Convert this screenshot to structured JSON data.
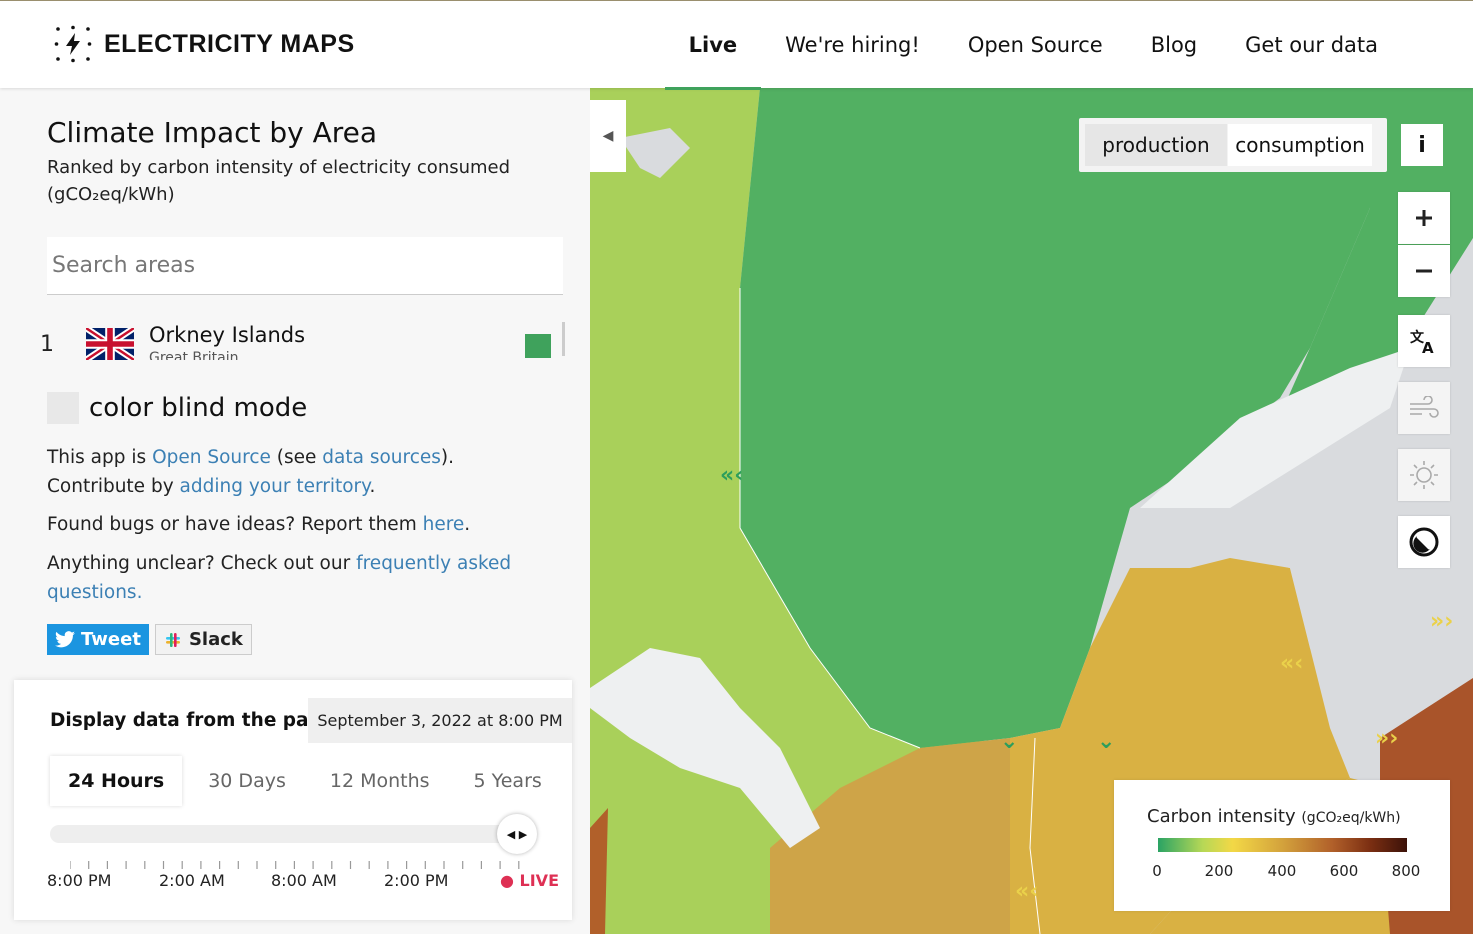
{
  "header": {
    "logo_text": "ELECTRICITY MAPS",
    "nav": [
      "Live",
      "We're hiring!",
      "Open Source",
      "Blog",
      "Get our data"
    ],
    "active_nav": "Live"
  },
  "sidebar": {
    "title": "Climate Impact by Area",
    "subtitle": "Ranked by carbon intensity of electricity consumed (gCO₂eq/kWh)",
    "search_placeholder": "Search areas",
    "ranking": [
      {
        "rank": "1",
        "name": "Orkney Islands",
        "country": "Great Britain",
        "color": "#3fa25c"
      }
    ],
    "color_blind_label": "color blind mode",
    "info": {
      "p1_a": "This app is ",
      "p1_link1": "Open Source",
      "p1_b": " (see ",
      "p1_link2": "data sources",
      "p1_c": "). Contribute by ",
      "p1_link3": "adding your territory",
      "p1_d": ".",
      "p2_a": "Found bugs or have ideas? Report them ",
      "p2_link": "here",
      "p2_b": ".",
      "p3_a": "Anything unclear? Check out our ",
      "p3_link": "frequently asked questions."
    },
    "share": {
      "tweet": "Tweet",
      "slack": "Slack"
    }
  },
  "timeline": {
    "title": "Display data from the past",
    "datetime": "September 3, 2022 at 8:00 PM",
    "tabs": [
      "24 Hours",
      "30 Days",
      "12 Months",
      "5 Years"
    ],
    "active_tab": "24 Hours",
    "tick_labels": [
      "8:00 PM",
      "2:00 AM",
      "8:00 AM",
      "2:00 PM"
    ],
    "live_label": "LIVE",
    "slider_position": 1.0
  },
  "map": {
    "mode_buttons": [
      "production",
      "consumption"
    ],
    "active_mode": "production",
    "info_label": "i",
    "controls": [
      "zoom-in-icon",
      "zoom-out-icon",
      "translate-icon",
      "wind-icon",
      "solar-icon",
      "dark-mode-icon"
    ],
    "legend": {
      "title": "Carbon intensity",
      "unit": "(gCO₂eq/kWh)",
      "labels": [
        "0",
        "200",
        "400",
        "600",
        "800"
      ],
      "colors": [
        "#2aa364",
        "#f3d846",
        "#d3a23c",
        "#b1602a",
        "#3c1209"
      ]
    }
  }
}
